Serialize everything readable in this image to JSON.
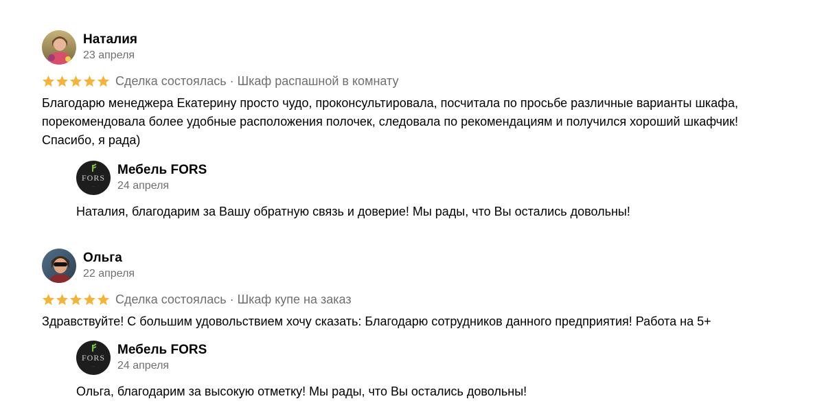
{
  "previous_text_cut": "...",
  "reviews": [
    {
      "author": "Наталия",
      "date": "23 апреля",
      "rating": 5,
      "deal": "Сделка состоялась · Шкаф распашной в комнату",
      "text_lines": [
        "Благодарю менеджера Екатерину просто чудо, проконсультировала, посчитала по просьбе различные варианты шкафа,",
        "порекомендовала более удобные расположения полочек, следовала по рекомендациям и получился хороший шкафчик!",
        "Спасибо, я рада)"
      ],
      "reply": {
        "author": "Мебель FORS",
        "date": "24 апреля",
        "text": "Наталия, благодарим за Вашу обратную связь и доверие! Мы рады, что Вы остались довольны!"
      }
    },
    {
      "author": "Ольга",
      "date": "22 апреля",
      "rating": 5,
      "deal": "Сделка состоялась · Шкаф купе на заказ",
      "text_lines": [
        "Здравствуйте! С большим удовольствием хочу сказать: Благодарю сотрудников данного предприятия! Работа на 5+"
      ],
      "reply": {
        "author": "Мебель FORS",
        "date": "24 апреля",
        "text": "Ольга, благодарим за высокую отметку! Мы рады, что Вы остались довольны!"
      }
    }
  ],
  "brand": {
    "logo_word": "FORS",
    "logo_tag": "...",
    "star_color": "#f4b43a",
    "muted_text_color": "#6f6f6f"
  },
  "icons": {
    "star": "star-icon",
    "company_logo": "fors-logo-icon"
  }
}
